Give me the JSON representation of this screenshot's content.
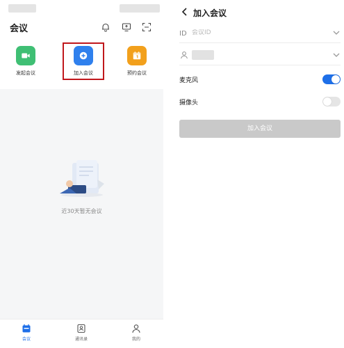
{
  "left": {
    "title": "会议",
    "actions": [
      {
        "label": "发起会议",
        "color": "#3fbf74",
        "icon": "video-icon"
      },
      {
        "label": "加入会议",
        "color": "#2f80ed",
        "icon": "plus-circle-icon"
      },
      {
        "label": "预约会议",
        "color": "#f2a01c",
        "icon": "calendar-icon"
      }
    ],
    "empty_text": "近30天暂无会议",
    "tabs": [
      {
        "label": "会议",
        "icon": "calendar-tab-icon",
        "active": true
      },
      {
        "label": "通讯录",
        "icon": "contacts-icon",
        "active": false
      },
      {
        "label": "我的",
        "icon": "person-icon",
        "active": false
      }
    ]
  },
  "right": {
    "title": "加入会议",
    "meeting_id": {
      "value": "",
      "placeholder": "会议ID"
    },
    "mic": {
      "label": "麦克风",
      "on": true
    },
    "camera": {
      "label": "摄像头",
      "on": false
    },
    "join_button": "加入会议"
  },
  "colors": {
    "accent": "#1e6fe8",
    "highlight": "#c0171b",
    "disabled_button": "#c9c9c9"
  }
}
